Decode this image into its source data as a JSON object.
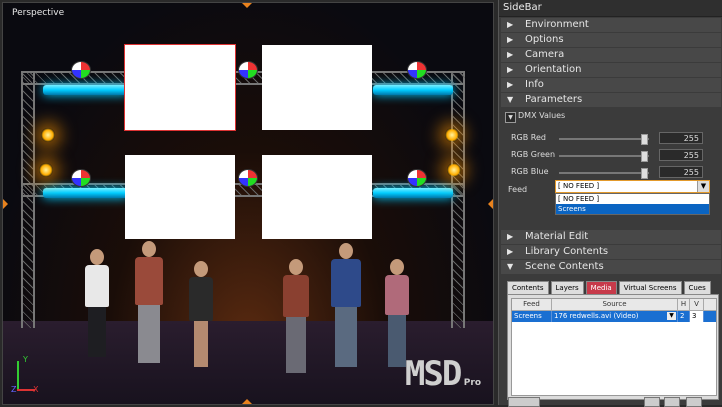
{
  "viewport": {
    "title": "Perspective",
    "logo_text": "MSD",
    "logo_sub": "Pro",
    "axis_x": "X",
    "axis_y": "Y",
    "axis_z": "Z"
  },
  "sidebar": {
    "title": "SideBar",
    "sections_top": [
      "Environment",
      "Options",
      "Camera",
      "Orientation",
      "Info"
    ],
    "parameters": {
      "label": "Parameters",
      "dmx_label": "DMX Values",
      "sliders": [
        {
          "label": "RGB Red",
          "value": "255"
        },
        {
          "label": "RGB Green",
          "value": "255"
        },
        {
          "label": "RGB Blue",
          "value": "255"
        }
      ],
      "feed_label": "Feed",
      "feed_value": "[ NO FEED ]",
      "feed_options": [
        "[ NO FEED ]",
        "Screens"
      ],
      "feed_selected_index": 1
    },
    "sections_bottom": [
      "Material Edit",
      "Library Contents"
    ],
    "scene_contents": {
      "label": "Scene Contents",
      "tabs": [
        "Contents",
        "Layers",
        "Media",
        "Virtual Screens",
        "Cues"
      ],
      "active_tab": "Media",
      "columns": [
        "Feed",
        "Source",
        "H",
        "V"
      ],
      "rows": [
        {
          "feed": "Screens",
          "source": "176 redwells.avi (Video)",
          "h": "2",
          "v": "3"
        }
      ]
    }
  },
  "colors": {
    "accent": "#c73a4a",
    "selection": "#1a6fd1",
    "cyan_light": "#00ccff",
    "amber_light": "#ffae00",
    "dropdown_border": "#e39a2c"
  }
}
